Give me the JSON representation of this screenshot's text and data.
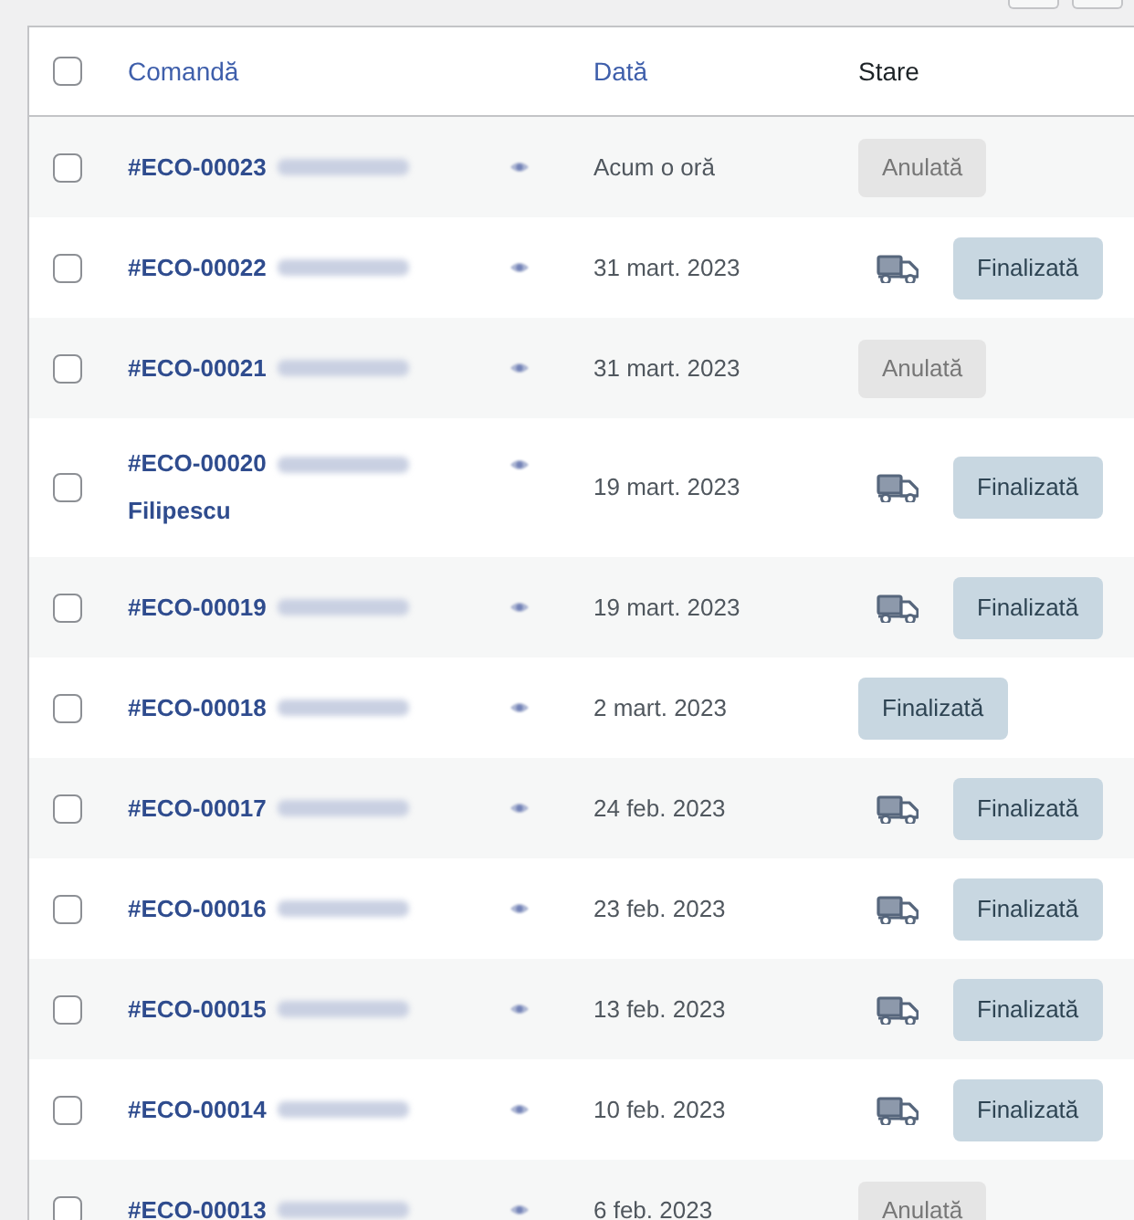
{
  "table": {
    "select_all": {
      "checked": false
    },
    "columns": [
      {
        "label": "Comandă",
        "sortable": true
      },
      {
        "label": "Dată",
        "sortable": true
      },
      {
        "label": "Stare",
        "sortable": false
      }
    ],
    "rows": [
      {
        "checked": false,
        "order": "#ECO-00023",
        "date": "Acum o oră",
        "shipping": false,
        "status": {
          "label": "Anulată",
          "kind": "cancelled"
        }
      },
      {
        "checked": false,
        "order": "#ECO-00022",
        "date": "31 mart. 2023",
        "shipping": true,
        "status": {
          "label": "Finalizată",
          "kind": "completed"
        }
      },
      {
        "checked": false,
        "order": "#ECO-00021",
        "date": "31 mart. 2023",
        "shipping": false,
        "status": {
          "label": "Anulată",
          "kind": "cancelled"
        }
      },
      {
        "checked": false,
        "order": "#ECO-00020",
        "name_line_2": "Filipescu",
        "date": "19 mart. 2023",
        "shipping": true,
        "status": {
          "label": "Finalizată",
          "kind": "completed"
        }
      },
      {
        "checked": false,
        "order": "#ECO-00019",
        "date": "19 mart. 2023",
        "shipping": true,
        "status": {
          "label": "Finalizată",
          "kind": "completed"
        }
      },
      {
        "checked": false,
        "order": "#ECO-00018",
        "date": "2 mart. 2023",
        "shipping": false,
        "status": {
          "label": "Finalizată",
          "kind": "completed"
        }
      },
      {
        "checked": false,
        "order": "#ECO-00017",
        "date": "24 feb. 2023",
        "shipping": true,
        "status": {
          "label": "Finalizată",
          "kind": "completed"
        }
      },
      {
        "checked": false,
        "order": "#ECO-00016",
        "date": "23 feb. 2023",
        "shipping": true,
        "status": {
          "label": "Finalizată",
          "kind": "completed"
        }
      },
      {
        "checked": false,
        "order": "#ECO-00015",
        "date": "13 feb. 2023",
        "shipping": true,
        "status": {
          "label": "Finalizată",
          "kind": "completed"
        }
      },
      {
        "checked": false,
        "order": "#ECO-00014",
        "date": "10 feb. 2023",
        "shipping": true,
        "status": {
          "label": "Finalizată",
          "kind": "completed"
        }
      },
      {
        "checked": false,
        "order": "#ECO-00013",
        "date": "6 feb. 2023",
        "shipping": false,
        "status": {
          "label": "Anulată",
          "kind": "cancelled"
        }
      }
    ]
  }
}
